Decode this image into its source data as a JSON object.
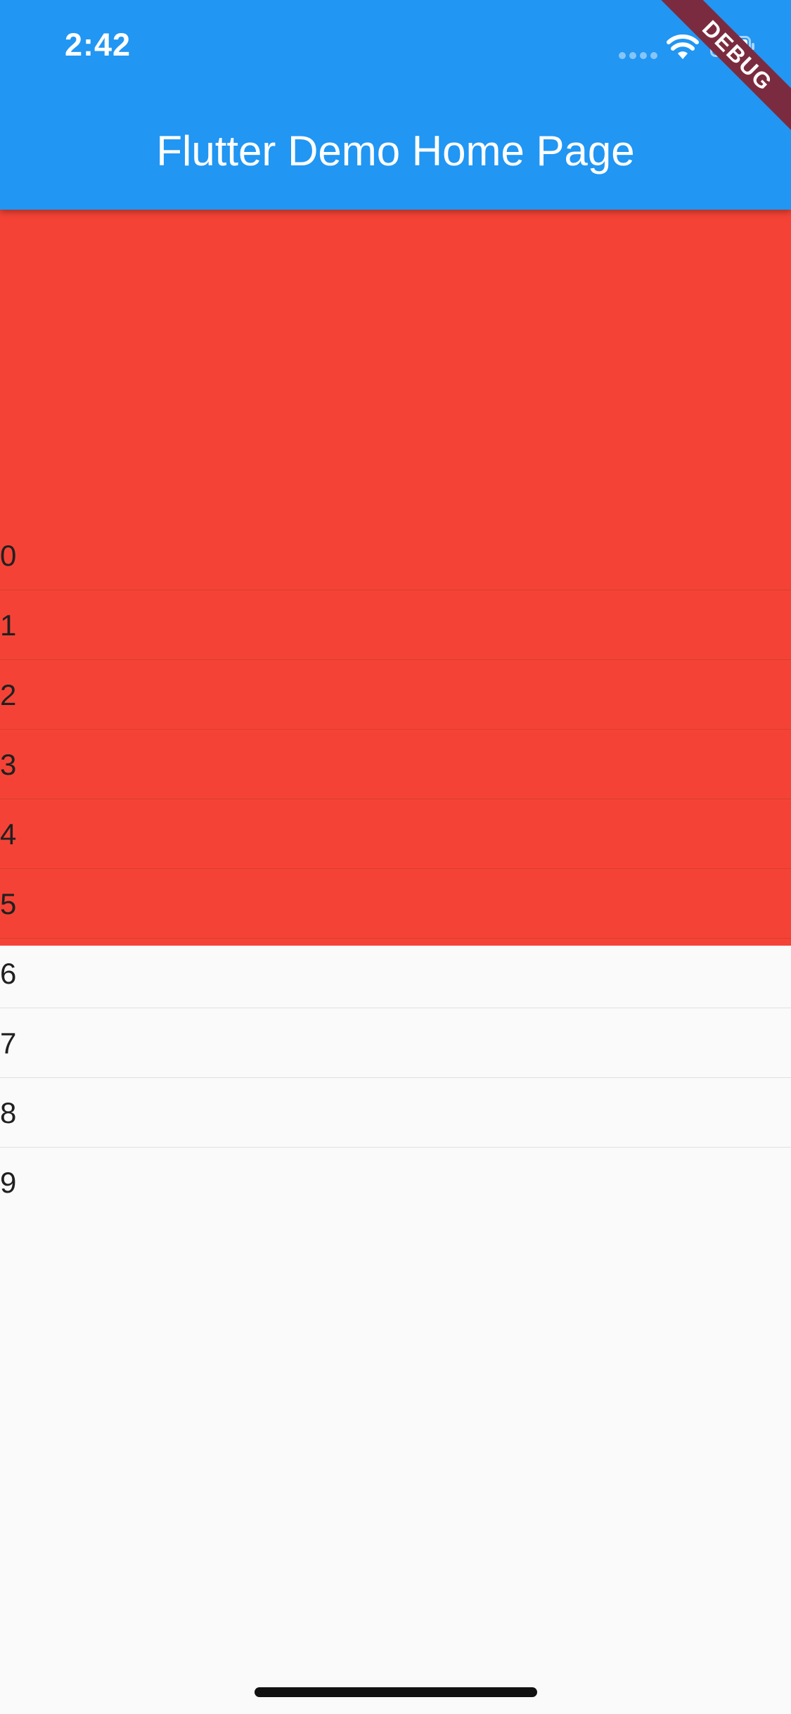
{
  "status_bar": {
    "time": "2:42",
    "icons": [
      "signal-dots-icon",
      "wifi-icon",
      "battery-icon"
    ]
  },
  "appbar": {
    "title": "Flutter Demo Home Page"
  },
  "list": {
    "items": [
      "0",
      "1",
      "2",
      "3",
      "4",
      "5",
      "6",
      "7",
      "8",
      "9"
    ]
  },
  "debug_banner": {
    "label": "DEBUG"
  },
  "colors": {
    "appbar": "#2196f3",
    "red_overlay": "#f44336",
    "background": "#fafafa",
    "debug_banner": "#7b2b3f"
  }
}
